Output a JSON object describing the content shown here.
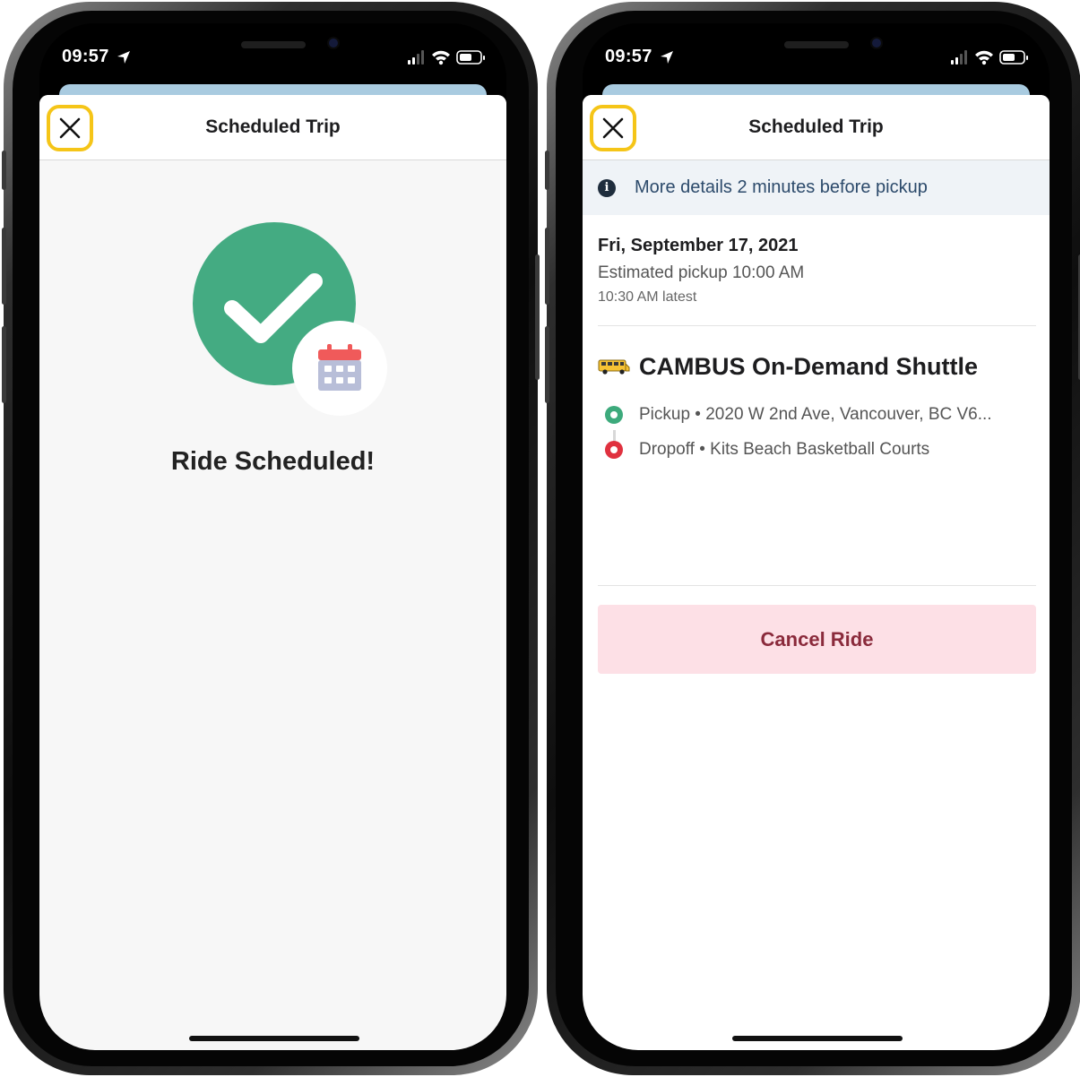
{
  "status_bar": {
    "time": "09:57"
  },
  "left_screen": {
    "nav": {
      "title": "Scheduled Trip",
      "close_icon": "close-icon"
    },
    "message": "Ride Scheduled!",
    "graphic": {
      "check_icon": "checkmark-icon",
      "calendar_icon": "calendar-icon"
    }
  },
  "right_screen": {
    "nav": {
      "title": "Scheduled Trip",
      "close_icon": "close-icon"
    },
    "info_banner": {
      "icon": "info-icon",
      "icon_glyph": "i",
      "text": "More details 2 minutes before pickup"
    },
    "trip": {
      "date": "Fri, September 17, 2021",
      "estimated_pickup": "Estimated pickup 10:00 AM",
      "latest": "10:30 AM latest"
    },
    "service": {
      "icon": "bus-icon",
      "name": "CAMBUS On-Demand Shuttle"
    },
    "stops": [
      {
        "type": "pickup",
        "text": "Pickup • 2020 W 2nd Ave, Vancouver, BC V6..."
      },
      {
        "type": "dropoff",
        "text": "Dropoff • Kits Beach Basketball Courts"
      }
    ],
    "cancel_button": "Cancel Ride"
  },
  "colors": {
    "highlight": "#f5c518",
    "success_green": "#44ab82",
    "pickup_green": "#3daa7c",
    "dropoff_red": "#e0313f",
    "cancel_bg": "#fde0e6",
    "cancel_text": "#8a2a3b",
    "info_bg": "#eff3f7",
    "info_text": "#2c4a6b"
  }
}
